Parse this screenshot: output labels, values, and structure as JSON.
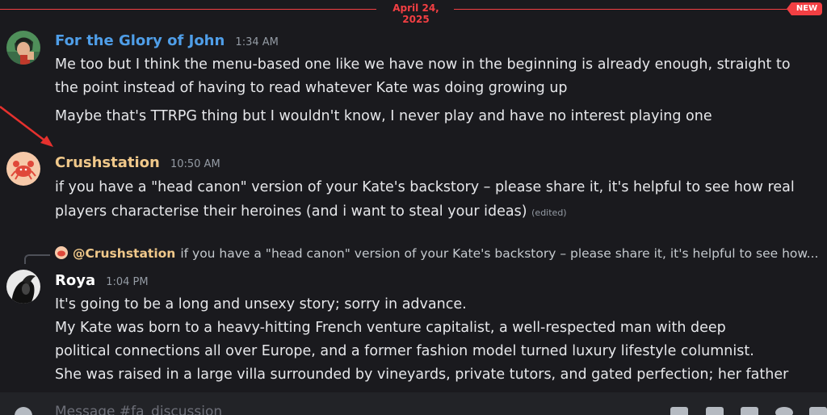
{
  "divider": {
    "date": "April 24, 2025",
    "new_label": "NEW",
    "color": "#f23f43"
  },
  "messages": [
    {
      "author": "For the Glory of John",
      "author_color": "#4f9ee8",
      "time": "1:34 AM",
      "lines": [
        "Me too but I think the menu-based  one like we have now in the beginning is already enough, straight to",
        "the point instead of having to read whatever Kate was doing growing up",
        "Maybe that's TTRPG thing but I wouldn't know, I never play and have no interest playing one"
      ]
    },
    {
      "author": "Crushstation",
      "author_color": "#f0c88a",
      "time": "10:50 AM",
      "lines": [
        "if you have a \"head canon\" version of your Kate's backstory – please share it, it's helpful to see how real",
        "players characterise their heroines (and i want to steal your ideas)"
      ],
      "edited": "(edited)"
    },
    {
      "author": "Roya",
      "author_color": "#ffffff",
      "time": "1:04 PM",
      "reply": {
        "mention": "@Crushstation",
        "preview": "if you have a \"head canon\" version of your Kate's backstory – please share it, it's helpful to see how..."
      },
      "lines": [
        "It's going to be a long and unsexy story; sorry in advance.",
        "My Kate was born to a heavy-hitting French venture capitalist, a well-respected man with deep",
        "political connections all over Europe, and a former fashion model turned luxury lifestyle columnist.",
        "She was raised in a large villa surrounded by vineyards, private tutors, and gated perfection; her father"
      ]
    }
  ],
  "composer": {
    "placeholder": "Message #fa_discussion",
    "icons": [
      "plus-icon",
      "gift-icon",
      "gif-icon",
      "sticker-icon",
      "emoji-icon",
      "apps-icon"
    ]
  },
  "annotation_color": "#e5312e"
}
